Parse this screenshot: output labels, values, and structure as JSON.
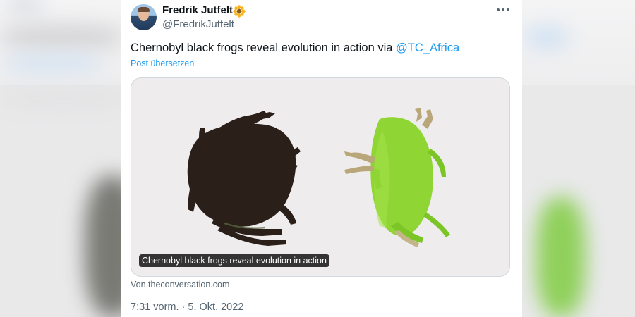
{
  "author": {
    "display_name": "Fredrik Jutfelt",
    "handle": "@FredrikJutfelt",
    "avatar_icon": "person-avatar",
    "badge_icon": "sunflower-emoji-icon"
  },
  "tweet": {
    "text": "Chernobyl black frogs reveal evolution in action via",
    "mention": "@TC_Africa",
    "translate_label": "Post übersetzen",
    "more_icon": "more-horizontal-icon"
  },
  "link_card": {
    "title": "Chernobyl black frogs reveal evolution in action",
    "source": "Von theconversation.com",
    "image": "black-frog-and-green-frog"
  },
  "meta": {
    "time": "7:31 vorm. · 5. Okt. 2022"
  },
  "colors": {
    "accent": "#1d9bf0",
    "text_primary": "#0f1419",
    "text_secondary": "#536471",
    "card_background": "#eeeced",
    "black_frog": "#2a1f19",
    "green_frog": "#8fd534"
  }
}
